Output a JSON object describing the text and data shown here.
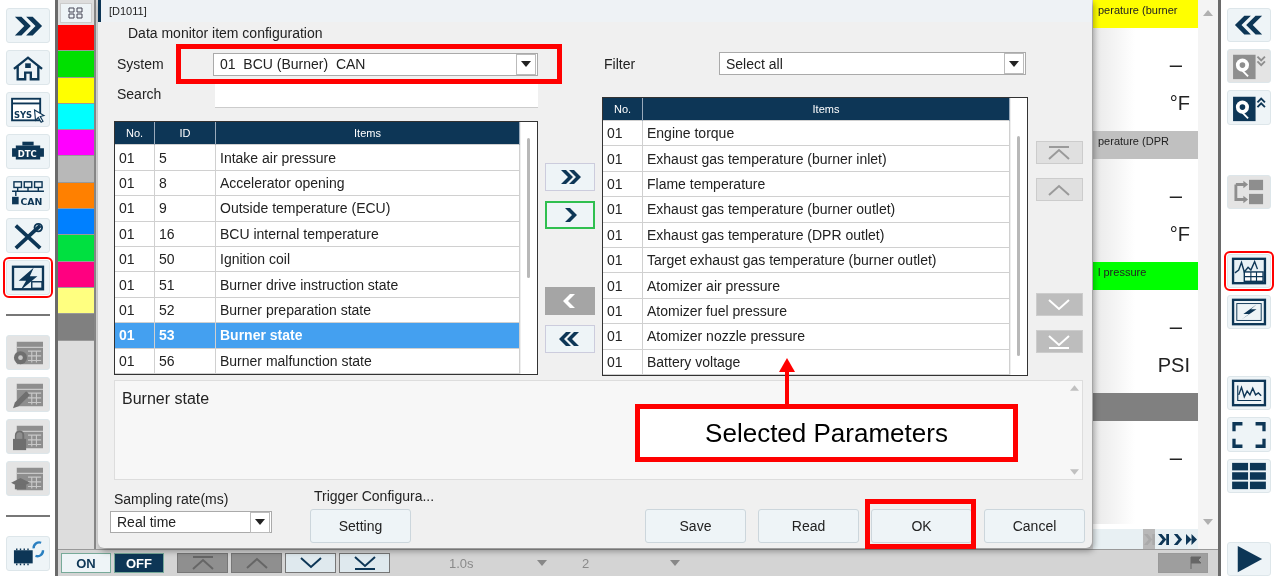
{
  "left_toolbar": [
    {
      "disabled": false,
      "highlighted": false
    },
    {
      "disabled": false,
      "highlighted": false
    },
    {
      "label": "SYS",
      "disabled": false,
      "highlighted": false
    },
    {
      "label": "DTC",
      "disabled": false,
      "highlighted": false
    },
    {
      "label": "CAN",
      "disabled": false,
      "highlighted": false
    },
    {
      "disabled": false,
      "highlighted": false
    },
    {
      "disabled": false,
      "highlighted": true
    },
    {
      "disabled": true,
      "highlighted": false
    },
    {
      "disabled": true,
      "highlighted": false
    },
    {
      "disabled": true,
      "highlighted": false
    },
    {
      "disabled": true,
      "highlighted": false
    },
    {
      "disabled": false,
      "highlighted": false
    }
  ],
  "color_strip": [
    {
      "color": "#ff0000"
    },
    {
      "color": "#00e000"
    },
    {
      "color": "#ffff00"
    },
    {
      "color": "#00ffff"
    },
    {
      "color": "#ff00ff"
    },
    {
      "color": "#b8b8b8"
    },
    {
      "color": "#ff8000"
    },
    {
      "color": "#0080ff"
    },
    {
      "color": "#00e040"
    },
    {
      "color": "#ff0080"
    },
    {
      "color": "#ffff80"
    },
    {
      "color": "#808080"
    }
  ],
  "dialog": {
    "title": "[D1011]",
    "heading": "Data monitor item configuration",
    "system": {
      "label": "System",
      "value": "01  BCU (Burner)  CAN",
      "highlighted": true
    },
    "search": {
      "label": "Search"
    },
    "filter": {
      "label": "Filter",
      "value": "Select all"
    },
    "available_items": {
      "columns": [
        "No.",
        "ID",
        "Items"
      ],
      "rows": [
        {
          "no": "01",
          "id": "5",
          "item": "Intake air pressure",
          "selected": false
        },
        {
          "no": "01",
          "id": "8",
          "item": "Accelerator opening",
          "selected": false
        },
        {
          "no": "01",
          "id": "9",
          "item": "Outside temperature (ECU)",
          "selected": false
        },
        {
          "no": "01",
          "id": "16",
          "item": "BCU internal temperature",
          "selected": false
        },
        {
          "no": "01",
          "id": "50",
          "item": "Ignition coil",
          "selected": false
        },
        {
          "no": "01",
          "id": "51",
          "item": "Burner drive instruction state",
          "selected": false
        },
        {
          "no": "01",
          "id": "52",
          "item": "Burner preparation state",
          "selected": false
        },
        {
          "no": "01",
          "id": "53",
          "item": "Burner state",
          "selected": true
        },
        {
          "no": "01",
          "id": "56",
          "item": "Burner malfunction state",
          "selected": false
        }
      ]
    },
    "transfer_buttons": [
      {
        "disabled": false,
        "focused": false
      },
      {
        "disabled": false,
        "focused": true
      },
      {
        "disabled": true,
        "focused": false
      },
      {
        "disabled": false,
        "focused": false
      }
    ],
    "selected_items": {
      "columns": [
        "No.",
        "Items"
      ],
      "rows": [
        {
          "no": "01",
          "item": "Engine torque",
          "selected": false
        },
        {
          "no": "01",
          "item": "Exhaust gas temperature (burner inlet)",
          "selected": false
        },
        {
          "no": "01",
          "item": "Flame temperature",
          "selected": false
        },
        {
          "no": "01",
          "item": "Exhaust gas temperature (burner outlet)",
          "selected": false
        },
        {
          "no": "01",
          "item": "Exhaust gas temperature (DPR outlet)",
          "selected": false
        },
        {
          "no": "01",
          "item": "Target exhaust gas temperature (burner outlet)",
          "selected": false
        },
        {
          "no": "01",
          "item": "Atomizer air pressure",
          "selected": false
        },
        {
          "no": "01",
          "item": "Atomizer fuel pressure",
          "selected": false
        },
        {
          "no": "01",
          "item": "Atomizer nozzle pressure",
          "selected": false
        },
        {
          "no": "01",
          "item": "Battery voltage",
          "selected": false
        }
      ]
    },
    "order_buttons": [
      {
        "disabled": true
      },
      {
        "disabled": true
      },
      {
        "disabled": true
      },
      {
        "disabled": true
      }
    ],
    "description": "Burner state",
    "sampling": {
      "label": "Sampling rate(ms)",
      "value": "Real time"
    },
    "trigger": {
      "label": "Trigger Configura...",
      "button": "Setting"
    },
    "buttons": [
      {
        "label": "Save",
        "highlighted": false
      },
      {
        "label": "Read",
        "highlighted": false
      },
      {
        "label": "OK",
        "highlighted": true
      },
      {
        "label": "Cancel",
        "highlighted": false
      }
    ],
    "callout": "Selected Parameters"
  },
  "monitor_tiles": [
    {
      "title": "perature (burner",
      "color": "#ffff00",
      "value": "–",
      "unit": "°F"
    },
    {
      "title": "perature (DPR",
      "color": "#c0c0c0",
      "value": "–",
      "unit": "°F"
    },
    {
      "title": "l pressure",
      "color": "#00ff00",
      "value": "–",
      "unit": "PSI"
    },
    {
      "color": "#808080",
      "value": "–"
    }
  ],
  "tile_nav": [
    {
      "disabled": true
    },
    {
      "disabled": false
    },
    {
      "disabled": false
    },
    {
      "disabled": false
    }
  ],
  "right_toolbar": [
    {
      "disabled": false,
      "highlighted": false
    },
    {
      "disabled": true,
      "highlighted": false
    },
    {
      "disabled": false,
      "highlighted": false
    },
    {
      "disabled": true,
      "highlighted": false
    },
    {
      "disabled": false,
      "highlighted": true
    },
    {
      "disabled": false,
      "highlighted": false
    },
    {
      "disabled": false,
      "highlighted": false
    },
    {
      "disabled": false,
      "highlighted": false
    },
    {
      "disabled": false,
      "highlighted": false
    },
    {
      "disabled": false,
      "highlighted": false
    }
  ],
  "bottom_bar": {
    "toggles": [
      {
        "label": "ON",
        "selected": false
      },
      {
        "label": "OFF",
        "selected": true
      }
    ],
    "scroll_buttons": [
      {
        "disabled": true
      },
      {
        "disabled": true
      },
      {
        "disabled": false
      },
      {
        "disabled": false
      }
    ],
    "dropdowns": [
      {
        "value": "1.0s",
        "disabled": true
      },
      {
        "value": "2",
        "disabled": true
      }
    ],
    "flag_button": {
      "disabled": true
    }
  }
}
